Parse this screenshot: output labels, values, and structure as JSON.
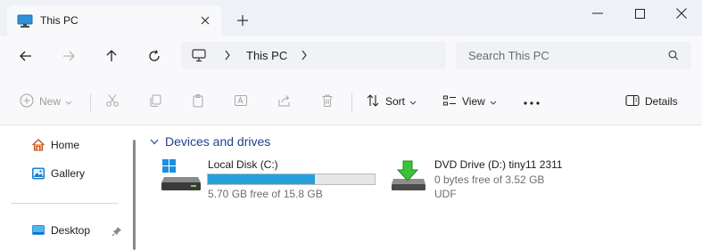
{
  "window": {
    "tab_title": "This PC",
    "new_tab_glyph": "+"
  },
  "address": {
    "location": "This PC",
    "search_placeholder": "Search This PC"
  },
  "commands": {
    "new": "New",
    "sort": "Sort",
    "view": "View",
    "details": "Details"
  },
  "sidebar": {
    "items": [
      {
        "label": "Home",
        "icon": "home-icon"
      },
      {
        "label": "Gallery",
        "icon": "gallery-icon"
      },
      {
        "label": "Desktop",
        "icon": "desktop-icon",
        "pinned": true
      }
    ]
  },
  "content": {
    "group_title": "Devices and drives",
    "drives": [
      {
        "name": "Local Disk (C:)",
        "free_text": "5.70 GB free of 15.8 GB",
        "used_fraction": 0.64,
        "icon": "hard-disk-icon"
      },
      {
        "name": "DVD Drive (D:) tiny11 2311",
        "free_text": "0 bytes free of 3.52 GB",
        "filesystem": "UDF",
        "icon": "dvd-drive-icon"
      }
    ]
  },
  "colors": {
    "accent": "#26a0da",
    "group_title": "#1f3f8f",
    "titlebar": "#eef1f6"
  }
}
